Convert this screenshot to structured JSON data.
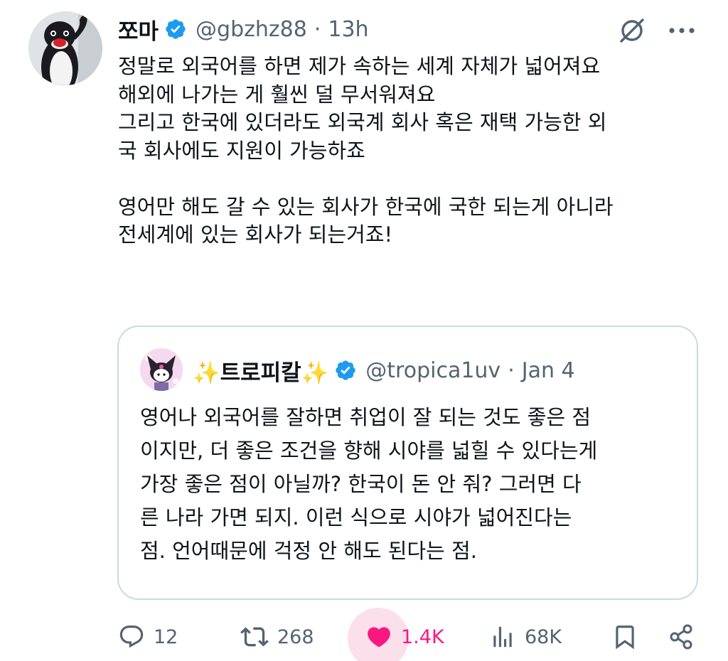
{
  "tweet": {
    "display_name": "쪼마",
    "handle": "@gbzhz88",
    "separator": "·",
    "time": "13h",
    "avatar_icon": "pingu-avatar",
    "text_lines": [
      "정말로 외국어를 하면 제가 속하는 세계 자체가 넓어져요",
      "해외에 나가는 게 훨씬 덜 무서워져요",
      "그리고 한국에 있더라도 외국계 회사 혹은 재택 가능한 외",
      "국 회사에도 지원이 가능하죠",
      "",
      "영어만 해도 갈 수 있는 회사가 한국에 국한 되는게 아니라",
      "전세계에 있는 회사가 되는거죠!"
    ]
  },
  "quote": {
    "display_name": "✨트로피칼✨",
    "handle": "@tropica1uv",
    "separator": "·",
    "time": "Jan 4",
    "avatar_icon": "kuromi-avatar",
    "text_lines": [
      "영어나 외국어를 잘하면 취업이 잘 되는 것도 좋은 점",
      "이지만, 더 좋은 조건을 향해 시야를 넓힐 수 있다는게",
      "가장 좋은 점이 아닐까? 한국이 돈 안 줘? 그러면 다",
      "른 나라 가면 되지. 이런 식으로 시야가 넓어진다는",
      "점. 언어때문에 걱정 안 해도 된다는 점."
    ]
  },
  "actions": {
    "replies": "12",
    "reposts": "268",
    "likes": "1.4K",
    "views": "68K"
  },
  "colors": {
    "text": "#0f1419",
    "secondary": "#536471",
    "verified": "#1d9bf0",
    "like": "#f91880",
    "border": "#cfd9de"
  },
  "icons": [
    "verified-badge-icon",
    "grok-icon",
    "more-icon",
    "reply-icon",
    "repost-icon",
    "like-icon",
    "views-icon",
    "bookmark-icon",
    "share-icon"
  ]
}
